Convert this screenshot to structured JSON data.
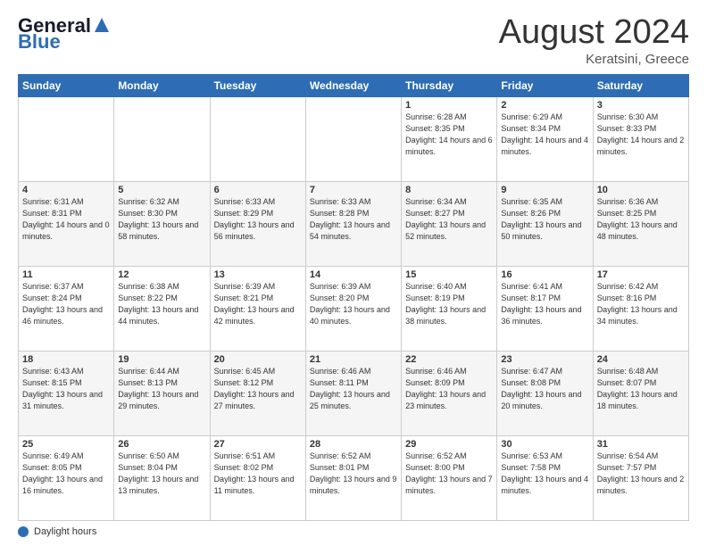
{
  "header": {
    "logo_general": "General",
    "logo_blue": "Blue",
    "month_title": "August 2024",
    "location": "Keratsini, Greece"
  },
  "days_of_week": [
    "Sunday",
    "Monday",
    "Tuesday",
    "Wednesday",
    "Thursday",
    "Friday",
    "Saturday"
  ],
  "footer": {
    "label": "Daylight hours"
  },
  "weeks": [
    [
      {
        "day": "",
        "sunrise": "",
        "sunset": "",
        "daylight": ""
      },
      {
        "day": "",
        "sunrise": "",
        "sunset": "",
        "daylight": ""
      },
      {
        "day": "",
        "sunrise": "",
        "sunset": "",
        "daylight": ""
      },
      {
        "day": "",
        "sunrise": "",
        "sunset": "",
        "daylight": ""
      },
      {
        "day": "1",
        "sunrise": "Sunrise: 6:28 AM",
        "sunset": "Sunset: 8:35 PM",
        "daylight": "Daylight: 14 hours and 6 minutes."
      },
      {
        "day": "2",
        "sunrise": "Sunrise: 6:29 AM",
        "sunset": "Sunset: 8:34 PM",
        "daylight": "Daylight: 14 hours and 4 minutes."
      },
      {
        "day": "3",
        "sunrise": "Sunrise: 6:30 AM",
        "sunset": "Sunset: 8:33 PM",
        "daylight": "Daylight: 14 hours and 2 minutes."
      }
    ],
    [
      {
        "day": "4",
        "sunrise": "Sunrise: 6:31 AM",
        "sunset": "Sunset: 8:31 PM",
        "daylight": "Daylight: 14 hours and 0 minutes."
      },
      {
        "day": "5",
        "sunrise": "Sunrise: 6:32 AM",
        "sunset": "Sunset: 8:30 PM",
        "daylight": "Daylight: 13 hours and 58 minutes."
      },
      {
        "day": "6",
        "sunrise": "Sunrise: 6:33 AM",
        "sunset": "Sunset: 8:29 PM",
        "daylight": "Daylight: 13 hours and 56 minutes."
      },
      {
        "day": "7",
        "sunrise": "Sunrise: 6:33 AM",
        "sunset": "Sunset: 8:28 PM",
        "daylight": "Daylight: 13 hours and 54 minutes."
      },
      {
        "day": "8",
        "sunrise": "Sunrise: 6:34 AM",
        "sunset": "Sunset: 8:27 PM",
        "daylight": "Daylight: 13 hours and 52 minutes."
      },
      {
        "day": "9",
        "sunrise": "Sunrise: 6:35 AM",
        "sunset": "Sunset: 8:26 PM",
        "daylight": "Daylight: 13 hours and 50 minutes."
      },
      {
        "day": "10",
        "sunrise": "Sunrise: 6:36 AM",
        "sunset": "Sunset: 8:25 PM",
        "daylight": "Daylight: 13 hours and 48 minutes."
      }
    ],
    [
      {
        "day": "11",
        "sunrise": "Sunrise: 6:37 AM",
        "sunset": "Sunset: 8:24 PM",
        "daylight": "Daylight: 13 hours and 46 minutes."
      },
      {
        "day": "12",
        "sunrise": "Sunrise: 6:38 AM",
        "sunset": "Sunset: 8:22 PM",
        "daylight": "Daylight: 13 hours and 44 minutes."
      },
      {
        "day": "13",
        "sunrise": "Sunrise: 6:39 AM",
        "sunset": "Sunset: 8:21 PM",
        "daylight": "Daylight: 13 hours and 42 minutes."
      },
      {
        "day": "14",
        "sunrise": "Sunrise: 6:39 AM",
        "sunset": "Sunset: 8:20 PM",
        "daylight": "Daylight: 13 hours and 40 minutes."
      },
      {
        "day": "15",
        "sunrise": "Sunrise: 6:40 AM",
        "sunset": "Sunset: 8:19 PM",
        "daylight": "Daylight: 13 hours and 38 minutes."
      },
      {
        "day": "16",
        "sunrise": "Sunrise: 6:41 AM",
        "sunset": "Sunset: 8:17 PM",
        "daylight": "Daylight: 13 hours and 36 minutes."
      },
      {
        "day": "17",
        "sunrise": "Sunrise: 6:42 AM",
        "sunset": "Sunset: 8:16 PM",
        "daylight": "Daylight: 13 hours and 34 minutes."
      }
    ],
    [
      {
        "day": "18",
        "sunrise": "Sunrise: 6:43 AM",
        "sunset": "Sunset: 8:15 PM",
        "daylight": "Daylight: 13 hours and 31 minutes."
      },
      {
        "day": "19",
        "sunrise": "Sunrise: 6:44 AM",
        "sunset": "Sunset: 8:13 PM",
        "daylight": "Daylight: 13 hours and 29 minutes."
      },
      {
        "day": "20",
        "sunrise": "Sunrise: 6:45 AM",
        "sunset": "Sunset: 8:12 PM",
        "daylight": "Daylight: 13 hours and 27 minutes."
      },
      {
        "day": "21",
        "sunrise": "Sunrise: 6:46 AM",
        "sunset": "Sunset: 8:11 PM",
        "daylight": "Daylight: 13 hours and 25 minutes."
      },
      {
        "day": "22",
        "sunrise": "Sunrise: 6:46 AM",
        "sunset": "Sunset: 8:09 PM",
        "daylight": "Daylight: 13 hours and 23 minutes."
      },
      {
        "day": "23",
        "sunrise": "Sunrise: 6:47 AM",
        "sunset": "Sunset: 8:08 PM",
        "daylight": "Daylight: 13 hours and 20 minutes."
      },
      {
        "day": "24",
        "sunrise": "Sunrise: 6:48 AM",
        "sunset": "Sunset: 8:07 PM",
        "daylight": "Daylight: 13 hours and 18 minutes."
      }
    ],
    [
      {
        "day": "25",
        "sunrise": "Sunrise: 6:49 AM",
        "sunset": "Sunset: 8:05 PM",
        "daylight": "Daylight: 13 hours and 16 minutes."
      },
      {
        "day": "26",
        "sunrise": "Sunrise: 6:50 AM",
        "sunset": "Sunset: 8:04 PM",
        "daylight": "Daylight: 13 hours and 13 minutes."
      },
      {
        "day": "27",
        "sunrise": "Sunrise: 6:51 AM",
        "sunset": "Sunset: 8:02 PM",
        "daylight": "Daylight: 13 hours and 11 minutes."
      },
      {
        "day": "28",
        "sunrise": "Sunrise: 6:52 AM",
        "sunset": "Sunset: 8:01 PM",
        "daylight": "Daylight: 13 hours and 9 minutes."
      },
      {
        "day": "29",
        "sunrise": "Sunrise: 6:52 AM",
        "sunset": "Sunset: 8:00 PM",
        "daylight": "Daylight: 13 hours and 7 minutes."
      },
      {
        "day": "30",
        "sunrise": "Sunrise: 6:53 AM",
        "sunset": "Sunset: 7:58 PM",
        "daylight": "Daylight: 13 hours and 4 minutes."
      },
      {
        "day": "31",
        "sunrise": "Sunrise: 6:54 AM",
        "sunset": "Sunset: 7:57 PM",
        "daylight": "Daylight: 13 hours and 2 minutes."
      }
    ]
  ]
}
